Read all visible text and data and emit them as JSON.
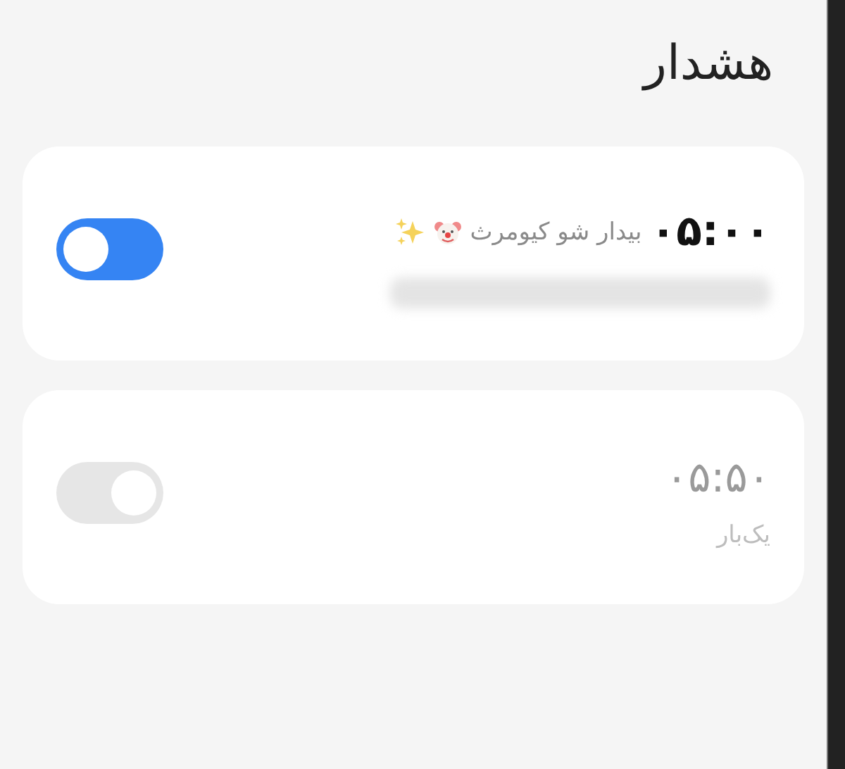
{
  "title": "هشدار",
  "alarms": [
    {
      "kind": "labeled",
      "time": "۰۵:۰۰",
      "label": "بیدار شو کیومرث",
      "on": true
    },
    {
      "kind": "plain",
      "time": "۰۵:۵۰",
      "label": "یک‌بار",
      "on": false
    }
  ]
}
